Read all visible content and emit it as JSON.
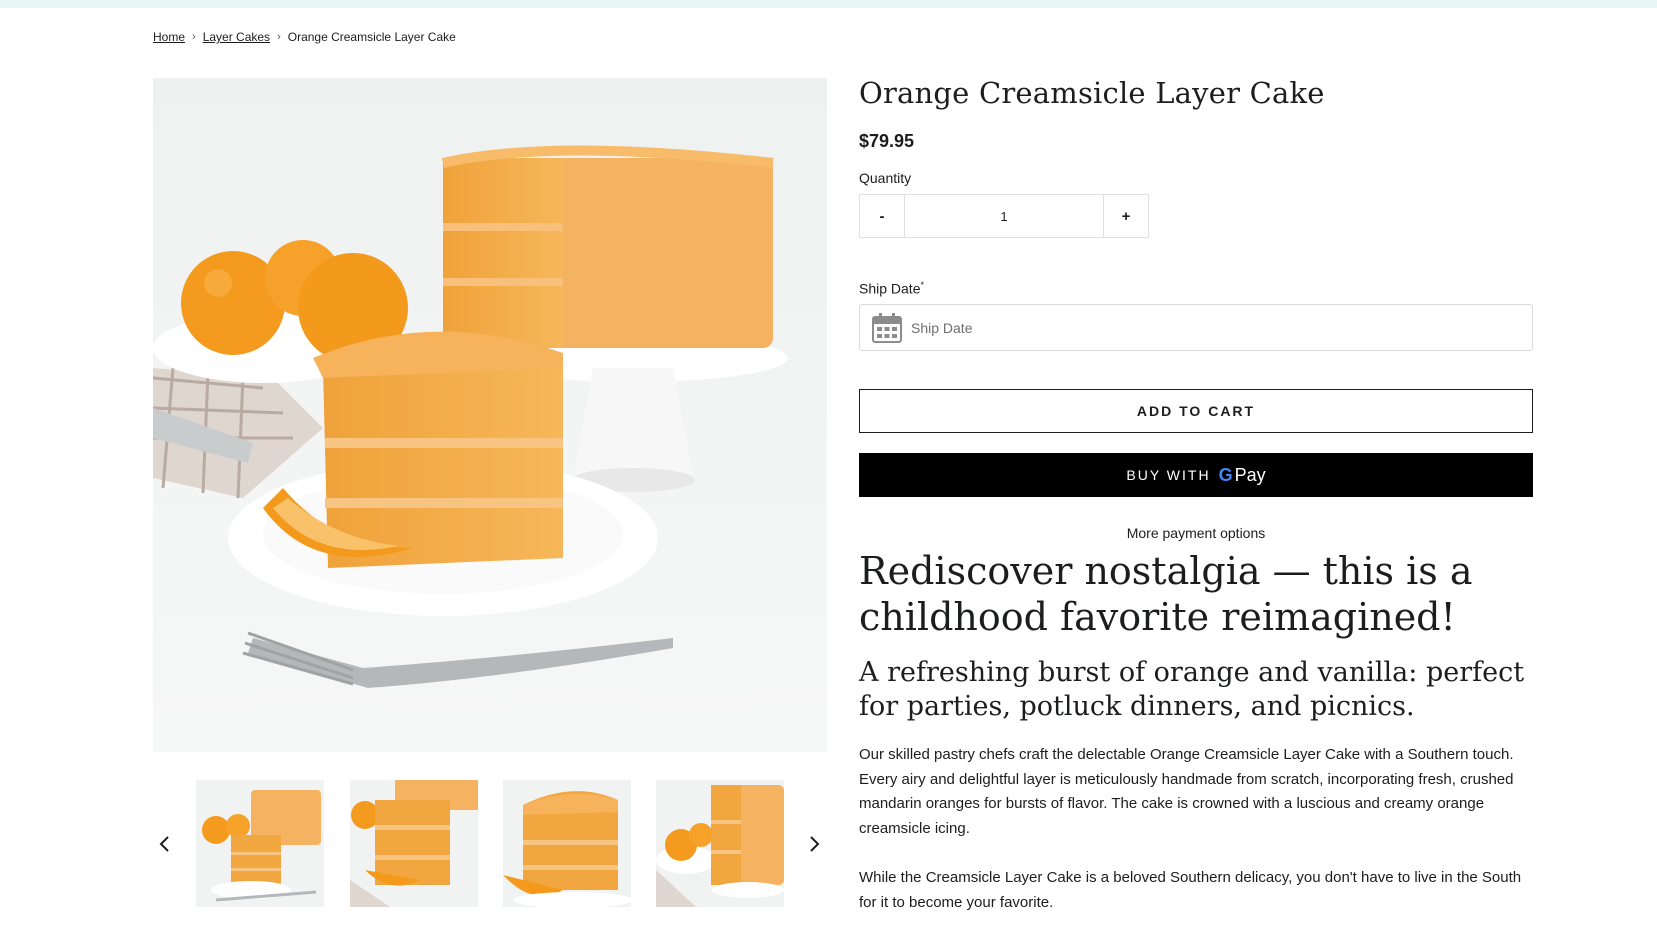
{
  "breadcrumb": {
    "home": "Home",
    "category": "Layer Cakes",
    "current": "Orange Creamsicle Layer Cake",
    "separator": "›"
  },
  "product": {
    "title": "Orange Creamsicle Layer Cake",
    "price": "$79.95",
    "image_alt": "Orange Creamsicle Layer Cake slice on plate with oranges"
  },
  "quantity": {
    "label": "Quantity",
    "minus": "-",
    "plus": "+",
    "value": "1"
  },
  "ship_date": {
    "label": "Ship Date",
    "required_mark": "*",
    "placeholder": "Ship Date",
    "icon": "calendar-icon"
  },
  "buttons": {
    "add_to_cart": "ADD TO CART",
    "buy_with": "BUY WITH",
    "gpay_g": "G",
    "gpay_pay": "Pay",
    "more_payment": "More payment options"
  },
  "gallery": {
    "prev_icon": "chevron-left-icon",
    "next_icon": "chevron-right-icon",
    "thumbnail_count": 4
  },
  "description": {
    "heading": "Rediscover nostalgia — this is a childhood favorite reimagined!",
    "subheading": "A refreshing burst of orange and vanilla: perfect for parties, potluck dinners, and picnics.",
    "paragraph1": "Our skilled pastry chefs craft the delectable Orange Creamsicle Layer Cake with a Southern touch. Every airy and delightful layer is meticulously handmade from scratch, incorporating fresh, crushed mandarin oranges for bursts of flavor. The cake is crowned with a luscious and creamy orange creamsicle icing.",
    "paragraph2": "While the Creamsicle Layer Cake is a beloved Southern delicacy, you don't have to live in the South for it to become your favorite."
  },
  "colors": {
    "topbar": "#e7f7f6",
    "text": "#1c1d1d",
    "cake": "#f2a640",
    "frosting": "#f5b562",
    "button_dark": "#000000"
  }
}
